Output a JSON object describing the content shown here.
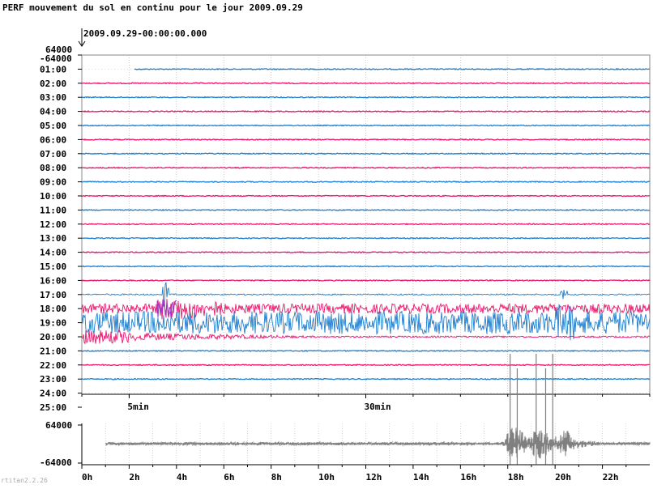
{
  "title": "PERF mouvement du sol en continu pour le jour 2009.09.29",
  "start_label": "2009.09.29-00:00:00.000",
  "scale_top": "64000",
  "scale_bottom": "-64000",
  "hour_labels": [
    "01:00",
    "02:00",
    "03:00",
    "04:00",
    "05:00",
    "06:00",
    "07:00",
    "08:00",
    "09:00",
    "10:00",
    "11:00",
    "12:00",
    "13:00",
    "14:00",
    "15:00",
    "16:00",
    "17:00",
    "18:00",
    "19:00",
    "20:00",
    "21:00",
    "22:00",
    "23:00",
    "24:00",
    "25:00"
  ],
  "minute_marks": [
    {
      "label": "5min",
      "minute": 5
    },
    {
      "label": "30min",
      "minute": 30
    }
  ],
  "summary_ticks": [
    "0h",
    "2h",
    "4h",
    "6h",
    "8h",
    "10h",
    "12h",
    "14h",
    "16h",
    "18h",
    "20h",
    "22h"
  ],
  "footer": "rtitan2.2.26",
  "colors": {
    "blue": "#1f7fd0",
    "magenta": "#e8186e",
    "purple": "#9a3bd0",
    "gray": "#808080",
    "grid": "#aaaaaa"
  },
  "chart_data": [
    {
      "type": "line",
      "title": "PERF mouvement du sol en continu pour le jour 2009.09.29",
      "description_of_axes": "helicorder: one trace per hour, x = minute within hour (0-60)",
      "x_ticks": [
        "5min",
        "30min"
      ],
      "xlim": [
        0,
        60
      ],
      "ylim": [
        -64000,
        64000
      ],
      "rows": [
        "01:00",
        "02:00",
        "03:00",
        "04:00",
        "05:00",
        "06:00",
        "07:00",
        "08:00",
        "09:00",
        "10:00",
        "11:00",
        "12:00",
        "13:00",
        "14:00",
        "15:00",
        "16:00",
        "17:00",
        "18:00",
        "19:00",
        "20:00",
        "21:00",
        "22:00",
        "23:00"
      ],
      "row_colors": [
        "blue",
        "magenta",
        "blue",
        "magenta",
        "blue",
        "magenta",
        "blue",
        "magenta",
        "blue",
        "magenta",
        "blue",
        "magenta",
        "blue",
        "magenta",
        "blue",
        "magenta",
        "blue",
        "magenta",
        "blue",
        "magenta",
        "blue",
        "magenta",
        "blue"
      ],
      "first_row_start_minute": 5.5,
      "active_rows": [
        "17:00",
        "18:00",
        "19:00",
        "20:00"
      ]
    },
    {
      "type": "line",
      "xlabel": "",
      "x_ticks": [
        "0h",
        "2h",
        "4h",
        "6h",
        "8h",
        "10h",
        "12h",
        "14h",
        "16h",
        "18h",
        "20h",
        "22h"
      ],
      "xlim": [
        0,
        24
      ],
      "ylim": [
        -64000,
        64000
      ],
      "y_ticks": [
        "64000",
        "-64000"
      ],
      "series": [
        {
          "start_hour": 1,
          "active_window": [
            17.8,
            20.8
          ],
          "peak": 64000
        }
      ]
    }
  ]
}
